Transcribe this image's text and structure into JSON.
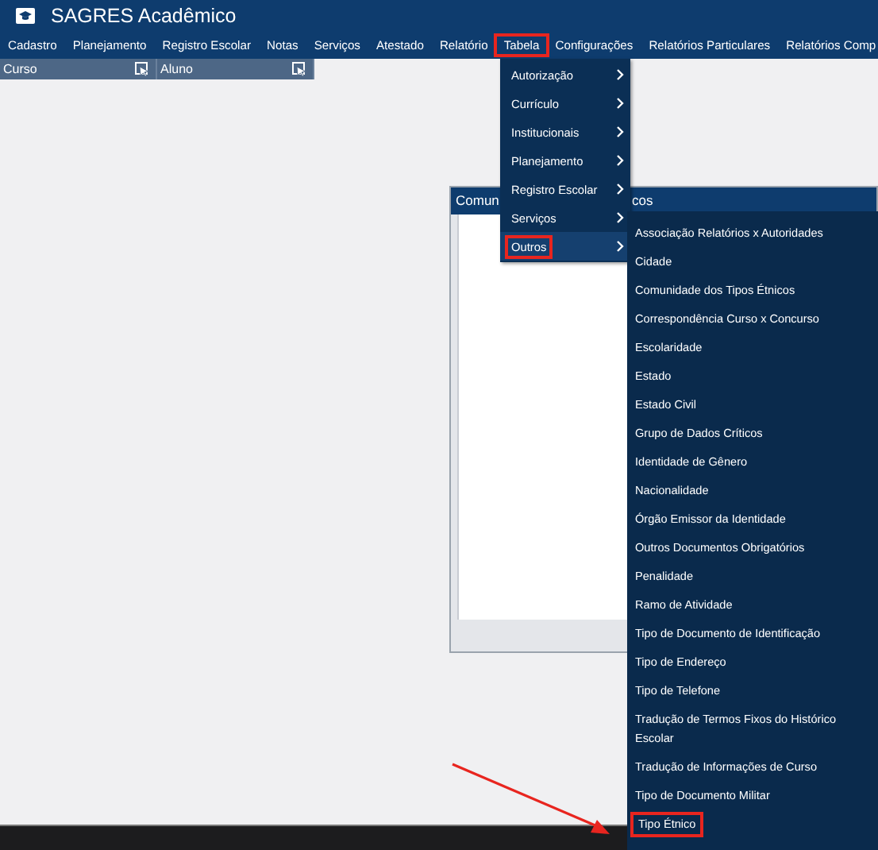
{
  "window": {
    "title": "SAGRES Acadêmico"
  },
  "menu_bar": [
    {
      "label": "Cadastro",
      "highlighted": false
    },
    {
      "label": "Planejamento",
      "highlighted": false
    },
    {
      "label": "Registro Escolar",
      "highlighted": false
    },
    {
      "label": "Notas",
      "highlighted": false
    },
    {
      "label": "Serviços",
      "highlighted": false
    },
    {
      "label": "Atestado",
      "highlighted": false
    },
    {
      "label": "Relatório",
      "highlighted": false
    },
    {
      "label": "Tabela",
      "highlighted": true
    },
    {
      "label": "Configurações",
      "highlighted": false
    },
    {
      "label": "Relatórios Particulares",
      "highlighted": false
    },
    {
      "label": "Relatórios Comp",
      "highlighted": false
    }
  ],
  "panels": [
    {
      "title": "Curso"
    },
    {
      "title": "Aluno"
    }
  ],
  "background_window": {
    "title_parts": [
      "Comun",
      "cos"
    ]
  },
  "tabela_menu": [
    {
      "label": "Autorização",
      "selected": false,
      "highlighted": false
    },
    {
      "label": "Currículo",
      "selected": false,
      "highlighted": false
    },
    {
      "label": "Institucionais",
      "selected": false,
      "highlighted": false
    },
    {
      "label": "Planejamento",
      "selected": false,
      "highlighted": false
    },
    {
      "label": "Registro Escolar",
      "selected": false,
      "highlighted": false
    },
    {
      "label": "Serviços",
      "selected": false,
      "highlighted": false
    },
    {
      "label": "Outros",
      "selected": true,
      "highlighted": true
    }
  ],
  "outros_menu": [
    {
      "label": "Associação Relatórios x Autoridades",
      "highlighted": false
    },
    {
      "label": "Cidade",
      "highlighted": false
    },
    {
      "label": "Comunidade dos Tipos Étnicos",
      "highlighted": false
    },
    {
      "label": "Correspondência Curso x Concurso",
      "highlighted": false
    },
    {
      "label": "Escolaridade",
      "highlighted": false
    },
    {
      "label": "Estado",
      "highlighted": false
    },
    {
      "label": "Estado Civil",
      "highlighted": false
    },
    {
      "label": "Grupo de Dados Críticos",
      "highlighted": false
    },
    {
      "label": "Identidade de Gênero",
      "highlighted": false
    },
    {
      "label": "Nacionalidade",
      "highlighted": false
    },
    {
      "label": "Órgão Emissor da Identidade",
      "highlighted": false
    },
    {
      "label": "Outros Documentos Obrigatórios",
      "highlighted": false
    },
    {
      "label": "Penalidade",
      "highlighted": false
    },
    {
      "label": "Ramo de Atividade",
      "highlighted": false
    },
    {
      "label": "Tipo de Documento de Identificação",
      "highlighted": false
    },
    {
      "label": "Tipo de Endereço",
      "highlighted": false
    },
    {
      "label": "Tipo de Telefone",
      "highlighted": false
    },
    {
      "label": "Tradução de Termos Fixos do Histórico Escolar",
      "highlighted": false
    },
    {
      "label": "Tradução de Informações de Curso",
      "highlighted": false
    },
    {
      "label": "Tipo de Documento Militar",
      "highlighted": false
    },
    {
      "label": "Tipo Étnico",
      "highlighted": true
    }
  ]
}
